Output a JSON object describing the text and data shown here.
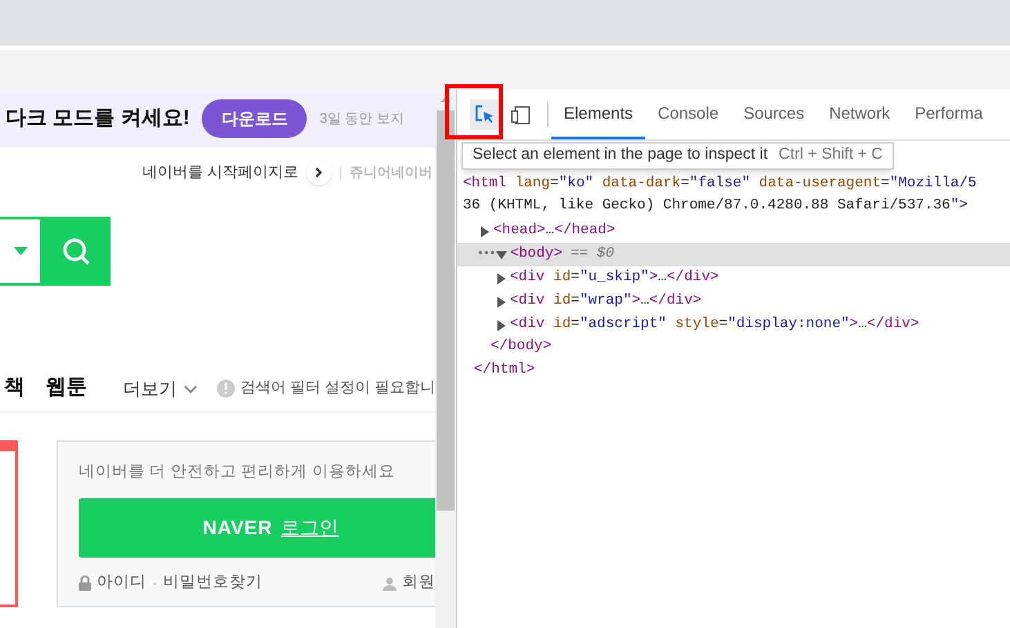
{
  "banner": {
    "headline": "다크 모드를 켜세요!",
    "button": "다운로드",
    "dismiss": "3일 동안 보지"
  },
  "top_links": {
    "start_page": "네이버를 시작페이지로",
    "junior": "쥬니어네이버"
  },
  "nav": {
    "items": [
      "책",
      "웹툰"
    ],
    "more": "더보기",
    "filter_notice": "검색어 필터 설정이 필요합니"
  },
  "login_card": {
    "message": "네이버를 더 안전하고 편리하게 이용하세요",
    "brand": "NAVER",
    "action": "로그인",
    "find_id": "아이디",
    "find_password": "비밀번호찾기",
    "signup": "회원"
  },
  "devtools": {
    "inspect_selected": true,
    "tabs": [
      {
        "label": "Elements",
        "selected": true
      },
      {
        "label": "Console",
        "selected": false
      },
      {
        "label": "Sources",
        "selected": false
      },
      {
        "label": "Network",
        "selected": false
      },
      {
        "label": "Performa",
        "selected": false
      }
    ],
    "tooltip": {
      "text": "Select an element in the page to inspect it",
      "shortcut": "Ctrl + Shift + C"
    },
    "tree": [
      {
        "text": "<html lang=\"ko\" data-dark=\"false\" data-useragent=\"Mozilla/5",
        "wrap": "36 (KHTML, like Gecko) Chrome/87.0.4280.88 Safari/537.36\">",
        "closing": "</html>",
        "children": [
          {
            "text": "<head>…</head>",
            "expanded": false,
            "selected": false
          },
          {
            "text": "<body>",
            "marker": "•••",
            "note": "== $0",
            "expanded": true,
            "selected": true,
            "closing": "</body>",
            "children": [
              {
                "text": "<div id=\"u_skip\">…</div>",
                "expanded": false,
                "selected": false
              },
              {
                "text": "<div id=\"wrap\">…</div>",
                "expanded": false,
                "selected": false
              },
              {
                "text": "<div id=\"adscript\" style=\"display:none\">…</div>",
                "expanded": false,
                "selected": false
              }
            ]
          }
        ]
      }
    ]
  }
}
